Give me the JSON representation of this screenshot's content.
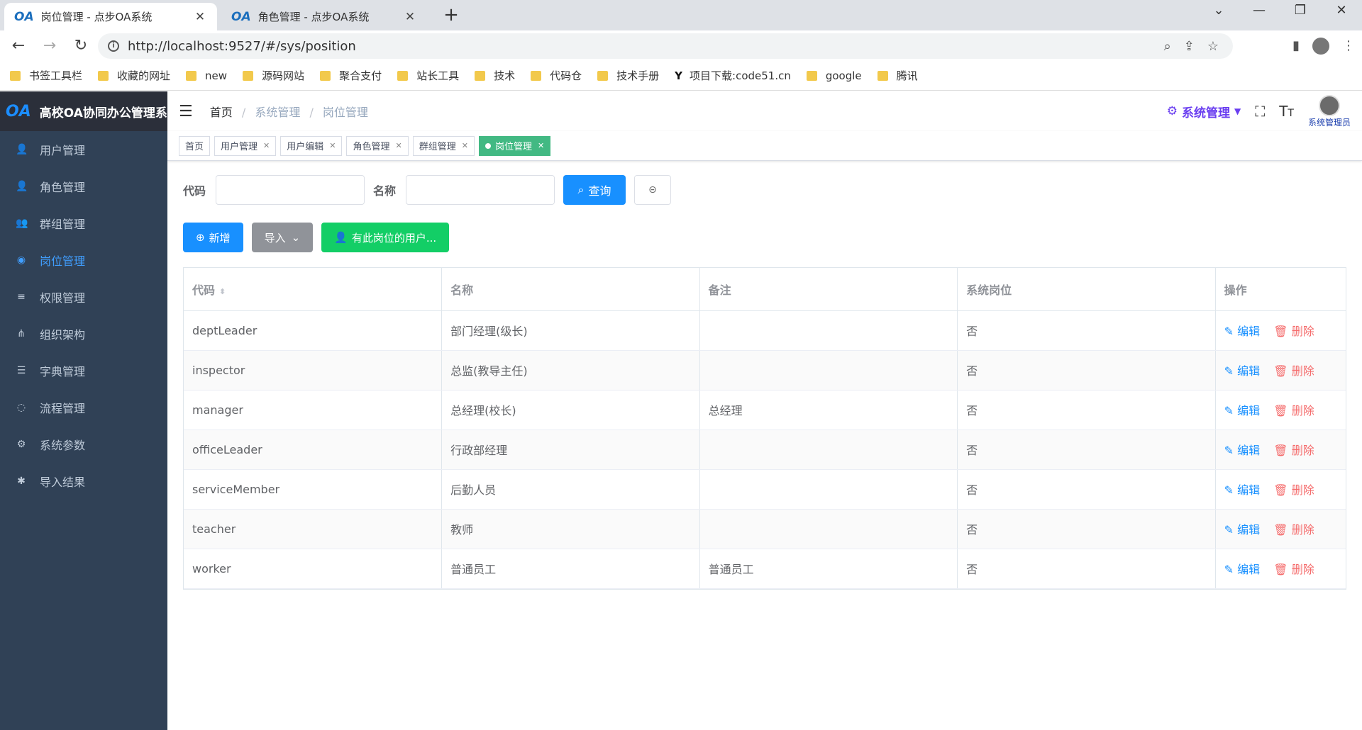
{
  "browser": {
    "tabs": [
      {
        "favicon": "OA",
        "title": "岗位管理 - 点步OA系统",
        "active": true
      },
      {
        "favicon": "OA",
        "title": "角色管理 - 点步OA系统",
        "active": false
      }
    ],
    "url": "http://localhost:9527/#/sys/position",
    "bookmarks": [
      "书签工具栏",
      "收藏的网址",
      "new",
      "源码网站",
      "聚合支付",
      "站长工具",
      "技术",
      "代码仓",
      "技术手册",
      "项目下载:code51.cn",
      "google",
      "腾讯"
    ]
  },
  "app": {
    "logo_icon": "OA",
    "title": "高校OA协同办公管理系统",
    "menu": [
      {
        "label": "用户管理",
        "icon": "user-icon",
        "glyph": "👤"
      },
      {
        "label": "角色管理",
        "icon": "role-icon",
        "glyph": "👤"
      },
      {
        "label": "群组管理",
        "icon": "group-icon",
        "glyph": "👥"
      },
      {
        "label": "岗位管理",
        "icon": "position-icon",
        "glyph": "◉",
        "active": true
      },
      {
        "label": "权限管理",
        "icon": "permission-icon",
        "glyph": "≡"
      },
      {
        "label": "组织架构",
        "icon": "org-tree-icon",
        "glyph": "⋔"
      },
      {
        "label": "字典管理",
        "icon": "list-icon",
        "glyph": "☰"
      },
      {
        "label": "流程管理",
        "icon": "flow-icon",
        "glyph": "◌"
      },
      {
        "label": "系统参数",
        "icon": "gear-icon",
        "glyph": "⚙"
      },
      {
        "label": "导入结果",
        "icon": "bug-icon",
        "glyph": "✱"
      }
    ],
    "breadcrumb": [
      "首页",
      "系统管理",
      "岗位管理"
    ],
    "system_menu": "系统管理",
    "user_name": "系统管理员",
    "tags": [
      "首页",
      "用户管理",
      "用户编辑",
      "角色管理",
      "群组管理",
      "岗位管理"
    ],
    "search": {
      "code_label": "代码",
      "name_label": "名称",
      "query_label": "查询"
    },
    "actions": {
      "add": "新增",
      "import": "导入",
      "users": "有此岗位的用户..."
    },
    "table": {
      "headers": [
        "代码",
        "名称",
        "备注",
        "系统岗位",
        "操作"
      ],
      "edit_label": "编辑",
      "delete_label": "删除",
      "rows": [
        {
          "code": "deptLeader",
          "name": "部门经理(级长)",
          "remark": "",
          "system": "否"
        },
        {
          "code": "inspector",
          "name": "总监(教导主任)",
          "remark": "",
          "system": "否"
        },
        {
          "code": "manager",
          "name": "总经理(校长)",
          "remark": "总经理",
          "system": "否"
        },
        {
          "code": "officeLeader",
          "name": "行政部经理",
          "remark": "",
          "system": "否"
        },
        {
          "code": "serviceMember",
          "name": "后勤人员",
          "remark": "",
          "system": "否"
        },
        {
          "code": "teacher",
          "name": "教师",
          "remark": "",
          "system": "否"
        },
        {
          "code": "worker",
          "name": "普通员工",
          "remark": "普通员工",
          "system": "否"
        }
      ]
    }
  }
}
